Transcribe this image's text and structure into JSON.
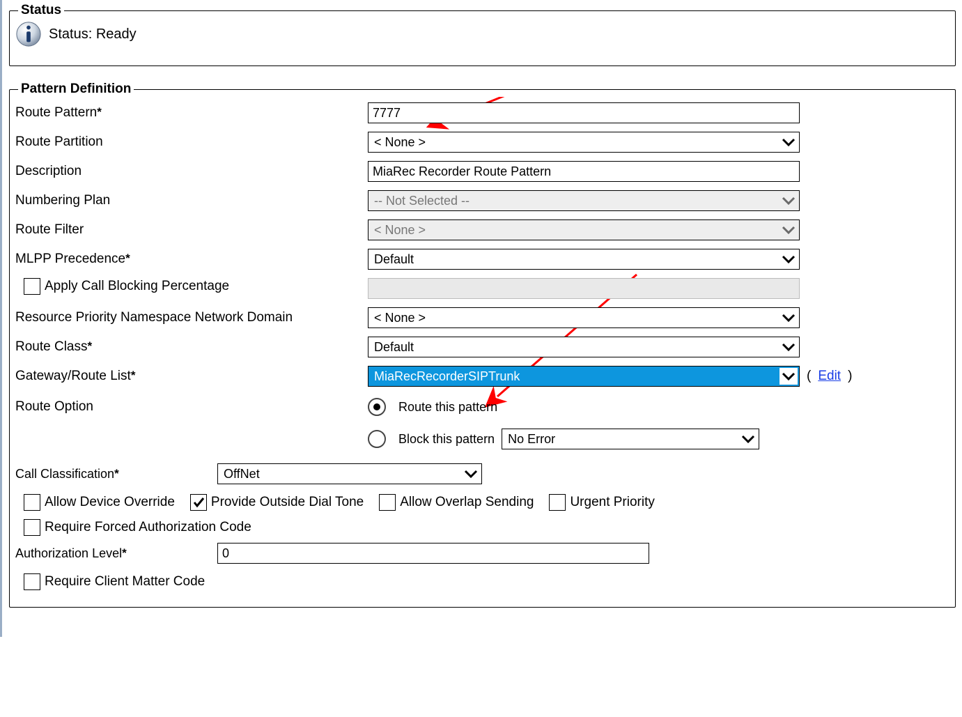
{
  "status": {
    "legend": "Status",
    "text": "Status: Ready"
  },
  "pattern": {
    "legend": "Pattern Definition",
    "route_pattern_label": "Route Pattern",
    "route_pattern_value": "7777",
    "route_partition_label": "Route Partition",
    "route_partition_value": "< None >",
    "description_label": "Description",
    "description_value": "MiaRec Recorder Route Pattern",
    "numbering_plan_label": "Numbering Plan",
    "numbering_plan_value": "-- Not Selected --",
    "route_filter_label": "Route Filter",
    "route_filter_value": "< None >",
    "mlpp_label": "MLPP Precedence",
    "mlpp_value": "Default",
    "apply_call_blocking_label": "Apply Call Blocking Percentage",
    "rpnnd_label": "Resource Priority Namespace Network Domain",
    "rpnnd_value": "< None >",
    "route_class_label": "Route Class",
    "route_class_value": "Default",
    "gateway_label": "Gateway/Route List",
    "gateway_value": "MiaRecRecorderSIPTrunk",
    "edit_text": "Edit",
    "route_option_label": "Route Option",
    "route_option_a": "Route this pattern",
    "route_option_b": "Block this pattern",
    "block_error_value": "No Error",
    "call_class_label": "Call Classification",
    "call_class_value": "OffNet",
    "chk_allow_device_override": "Allow Device Override",
    "chk_outside_dial_tone": "Provide Outside Dial Tone",
    "chk_overlap_sending": "Allow Overlap Sending",
    "chk_urgent_priority": "Urgent Priority",
    "chk_forced_auth": "Require Forced Authorization Code",
    "auth_level_label": "Authorization Level",
    "auth_level_value": "0",
    "chk_client_matter": "Require Client Matter Code"
  }
}
